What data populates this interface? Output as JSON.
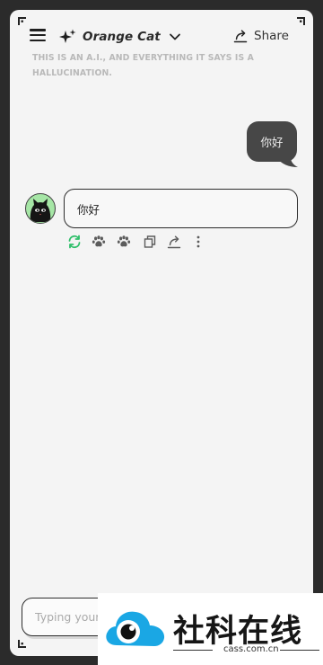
{
  "header": {
    "model_name": "Orange Cat",
    "share_label": "Share"
  },
  "disclaimer": "THIS IS AN A.I., AND EVERYTHING IT SAYS IS A HALLUCINATION.",
  "messages": {
    "user": "你好",
    "bot": "你好"
  },
  "actions": [
    "regenerate-icon",
    "paw-icon",
    "paw-icon",
    "copy-icon",
    "share-icon",
    "more-icon"
  ],
  "accent_color": "#2fbf6a",
  "input": {
    "placeholder": "Typing your message..."
  },
  "watermark": {
    "title": "社科在线",
    "url": "cass.com.cn"
  }
}
